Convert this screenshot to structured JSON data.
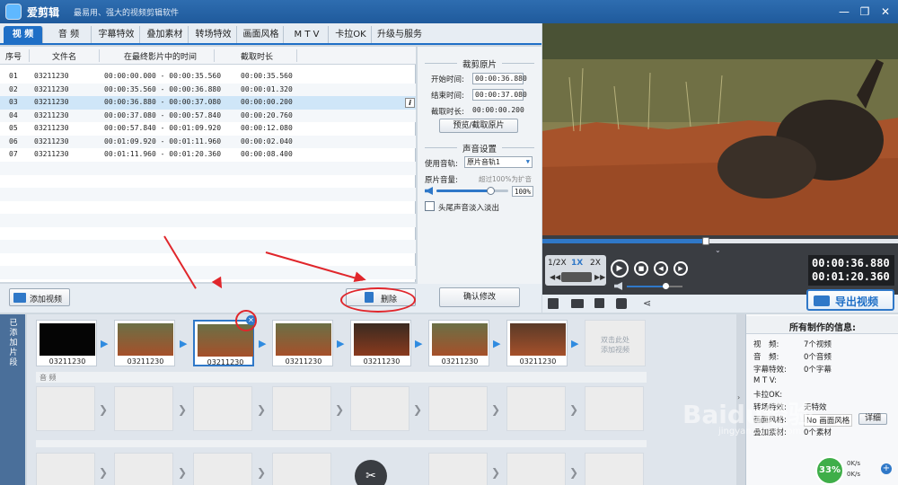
{
  "window": {
    "app_name": "爱剪辑",
    "slogan": "最易用、强大的视频剪辑软件",
    "controls": {
      "minimize": "—",
      "restore": "❐",
      "close": "✕"
    }
  },
  "tabs": [
    "视 频",
    "音 频",
    "字幕特效",
    "叠加素材",
    "转场特效",
    "画面风格",
    "M T V",
    "卡拉OK",
    "升级与服务"
  ],
  "table": {
    "headers": [
      "序号",
      "文件名",
      "在最终影片中的时间",
      "截取时长"
    ],
    "rows": [
      [
        "01",
        "03211230",
        "00:00:00.000 - 00:00:35.560",
        "00:00:35.560"
      ],
      [
        "02",
        "03211230",
        "00:00:35.560 - 00:00:36.880",
        "00:00:01.320"
      ],
      [
        "03",
        "03211230",
        "00:00:36.880 - 00:00:37.080",
        "00:00:00.200"
      ],
      [
        "04",
        "03211230",
        "00:00:37.080 - 00:00:57.840",
        "00:00:20.760"
      ],
      [
        "05",
        "03211230",
        "00:00:57.840 - 00:01:09.920",
        "00:00:12.080"
      ],
      [
        "06",
        "03211230",
        "00:01:09.920 - 00:01:11.960",
        "00:00:02.040"
      ],
      [
        "07",
        "03211230",
        "00:01:11.960 - 00:01:20.360",
        "00:00:08.400"
      ]
    ],
    "info_icon": "i"
  },
  "buttons": {
    "add_video": "添加视频",
    "delete": "删除",
    "confirm": "确认修改",
    "preview_cut": "预览/截取原片",
    "export": "导出视频",
    "detail": "详细"
  },
  "trim": {
    "title": "裁剪原片",
    "start_label": "开始时间:",
    "start_value": "00:00:36.880",
    "end_label": "结束时间:",
    "end_value": "00:00:37.080",
    "duration_label": "截取时长:",
    "duration_value": "00:00:00.200"
  },
  "audio_settings": {
    "title": "声音设置",
    "track_label": "使用音轨:",
    "track_value": "原片音轨1",
    "volume_label": "原片音量:",
    "volume_hint": "超过100%为扩音",
    "volume_value": "100%",
    "volume_level": 0.75,
    "fade_label": "头尾声音淡入淡出"
  },
  "player": {
    "speeds": [
      "1/2X",
      "1X",
      "2X"
    ],
    "time_current": "00:00:36.880",
    "time_total": "00:01:20.360",
    "progress": 0.46,
    "volume_level": 0.7
  },
  "timeline": {
    "side_label": "已添加片段",
    "clips": [
      "03211230",
      "03211230",
      "03211230",
      "03211230",
      "03211230",
      "03211230",
      "03211230"
    ],
    "add_hint_1": "双击此处",
    "add_hint_2": "添加视频",
    "audio_label": "音 频"
  },
  "info_panel": {
    "title": "所有制作的信息:",
    "rows": [
      [
        "视　频:",
        "7个视频"
      ],
      [
        "音　频:",
        "0个音频"
      ],
      [
        "字幕特效:",
        "0个字幕"
      ],
      [
        "M T V:",
        ""
      ],
      [
        "卡拉OK:",
        ""
      ],
      [
        "转场特效:",
        "无特效"
      ],
      [
        "画面风格:",
        "No 画面风格"
      ],
      [
        "叠加素材:",
        "0个素材"
      ]
    ],
    "badge": "33%",
    "speed_up": "0K/s",
    "speed_down": "0K/s"
  },
  "watermark": {
    "main": "Baidu经验",
    "sub": "jingyan.baidu.com"
  }
}
